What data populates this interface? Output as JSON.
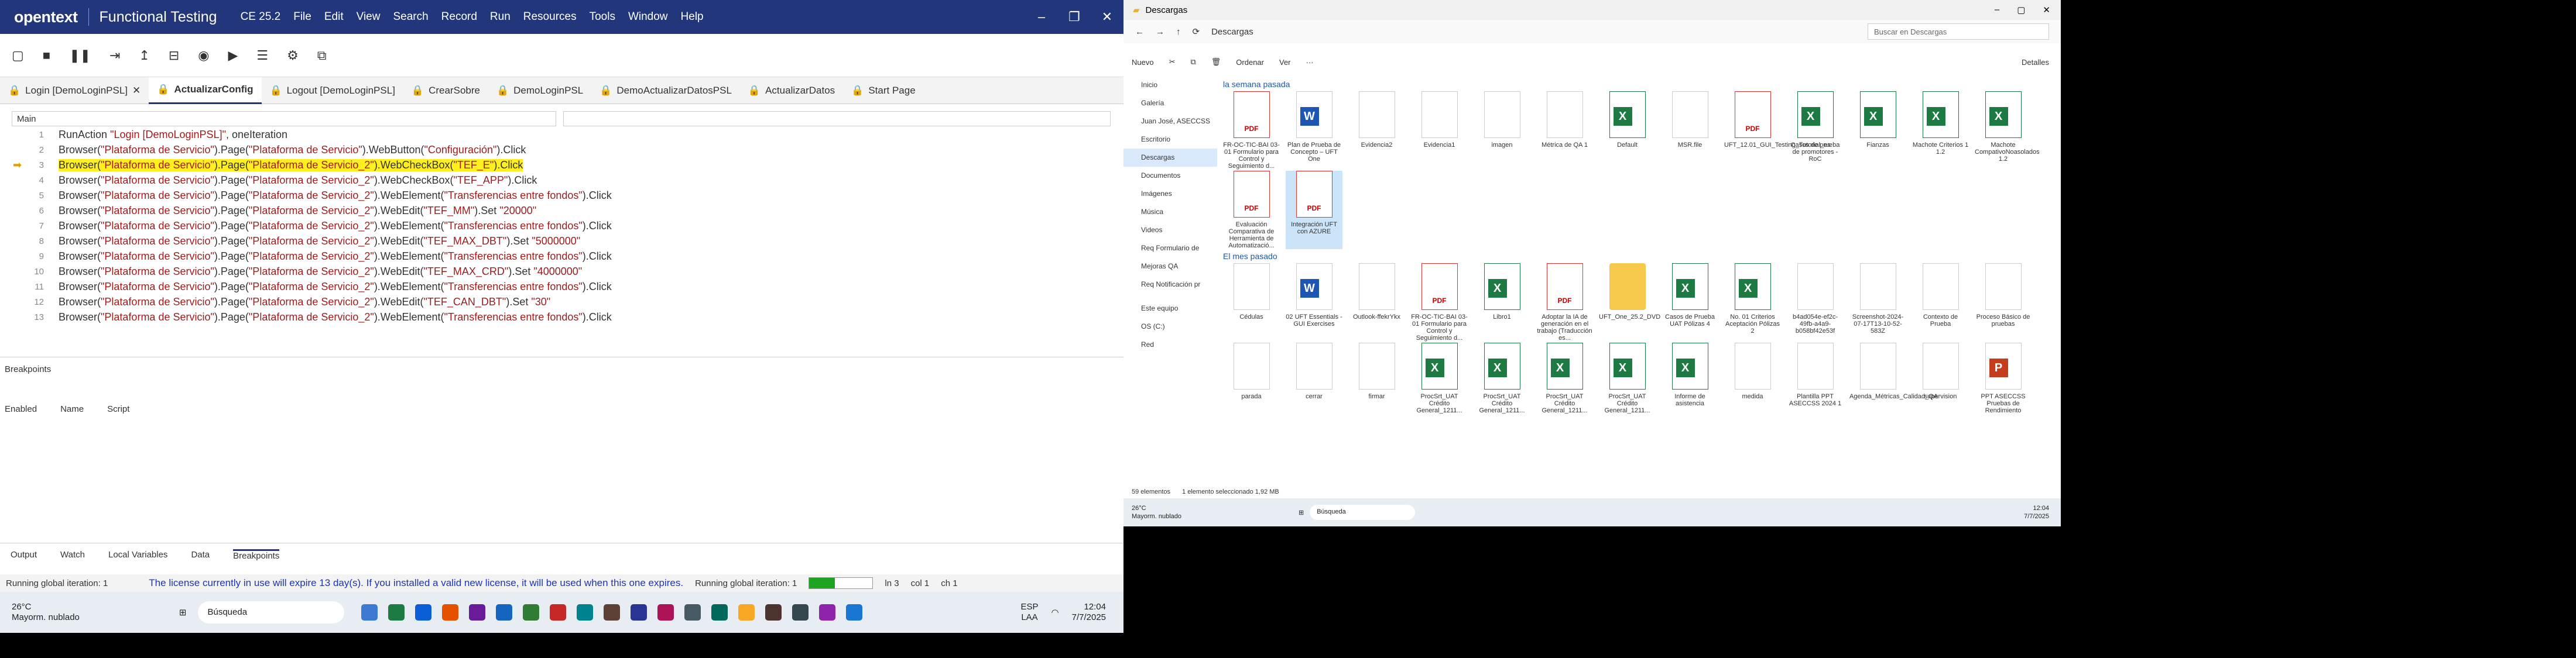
{
  "ide": {
    "logo": "opentext",
    "title": "Functional Testing",
    "version": "CE 25.2",
    "menu": [
      "File",
      "Edit",
      "View",
      "Search",
      "Record",
      "Run",
      "Resources",
      "Tools",
      "Window",
      "Help"
    ],
    "tabs": [
      "Login [DemoLoginPSL]",
      "ActualizarConfig",
      "Logout [DemoLoginPSL]",
      "CrearSobre",
      "DemoLoginPSL",
      "DemoActualizarDatosPSL",
      "ActualizarDatos",
      "Start Page"
    ],
    "combo_left": "Main",
    "lines": [
      {
        "n": "1",
        "t": "RunAction \"Login [DemoLoginPSL]\", oneIteration"
      },
      {
        "n": "2",
        "t": "Browser(\"Plataforma de Servicio\").Page(\"Plataforma de Servicio\").WebButton(\"Configuración\").Click"
      },
      {
        "n": "3",
        "t": "Browser(\"Plataforma de Servicio\").Page(\"Plataforma de Servicio_2\").WebCheckBox(\"TEF_E\").Click"
      },
      {
        "n": "4",
        "t": "Browser(\"Plataforma de Servicio\").Page(\"Plataforma de Servicio_2\").WebCheckBox(\"TEF_APP\").Click"
      },
      {
        "n": "5",
        "t": "Browser(\"Plataforma de Servicio\").Page(\"Plataforma de Servicio_2\").WebElement(\"Transferencias entre fondos\").Click"
      },
      {
        "n": "6",
        "t": "Browser(\"Plataforma de Servicio\").Page(\"Plataforma de Servicio_2\").WebEdit(\"TEF_MM\").Set \"20000\""
      },
      {
        "n": "7",
        "t": "Browser(\"Plataforma de Servicio\").Page(\"Plataforma de Servicio_2\").WebElement(\"Transferencias entre fondos\").Click"
      },
      {
        "n": "8",
        "t": "Browser(\"Plataforma de Servicio\").Page(\"Plataforma de Servicio_2\").WebEdit(\"TEF_MAX_DBT\").Set \"5000000\""
      },
      {
        "n": "9",
        "t": "Browser(\"Plataforma de Servicio\").Page(\"Plataforma de Servicio_2\").WebElement(\"Transferencias entre fondos\").Click"
      },
      {
        "n": "10",
        "t": "Browser(\"Plataforma de Servicio\").Page(\"Plataforma de Servicio_2\").WebEdit(\"TEF_MAX_CRD\").Set \"4000000\""
      },
      {
        "n": "11",
        "t": "Browser(\"Plataforma de Servicio\").Page(\"Plataforma de Servicio_2\").WebElement(\"Transferencias entre fondos\").Click"
      },
      {
        "n": "12",
        "t": "Browser(\"Plataforma de Servicio\").Page(\"Plataforma de Servicio_2\").WebEdit(\"TEF_CAN_DBT\").Set \"30\""
      },
      {
        "n": "13",
        "t": "Browser(\"Plataforma de Servicio\").Page(\"Plataforma de Servicio_2\").WebElement(\"Transferencias entre fondos\").Click"
      }
    ],
    "breakpoints_title": "Breakpoints",
    "bp_cols": [
      "Enabled",
      "Name",
      "Script"
    ],
    "bottom_tabs": [
      "Output",
      "Watch",
      "Local Variables",
      "Data",
      "Breakpoints"
    ],
    "status_left": "Running global iteration: 1",
    "license": "The license currently in use will expire 13 day(s). If you installed a valid new license, it will be used when this one expires.",
    "status_right": "Running global iteration: 1",
    "progress": 0.4,
    "ln": "ln 3",
    "col": "col 1",
    "ch": "ch 1",
    "weather_temp": "26°C",
    "weather_desc": "Mayorm. nublado",
    "search": "Búsqueda",
    "lang": "ESP",
    "lang2": "LAA",
    "time": "12:04",
    "date": "7/7/2025"
  },
  "explorer": {
    "title": "Descargas",
    "address": "Descargas",
    "search": "Buscar en Descargas",
    "cmd": [
      "Nuevo",
      "Ordenar",
      "Ver",
      "Detalles"
    ],
    "nav": [
      "Inicio",
      "Galería",
      "Juan José, ASECCSS",
      "Escritorio",
      "Descargas",
      "Documentos",
      "Imágenes",
      "Música",
      "Videos",
      "Req Formulario de",
      "Mejoras QA",
      "Req Notificación pr",
      "Este equipo",
      "OS (C:)",
      "Red"
    ],
    "week_label": "la semana pasada",
    "month_label": "El mes pasado",
    "week_files": [
      {
        "n": "FR-OC-TIC-BAI 03-01 Formulario para Control y Seguimiento d...",
        "k": "pdf"
      },
      {
        "n": "Plan de Prueba de Concepto – UFT One",
        "k": "wd"
      },
      {
        "n": "Evidencia2",
        "k": "img"
      },
      {
        "n": "Evidencia1",
        "k": "img"
      },
      {
        "n": "imagen",
        "k": "img"
      },
      {
        "n": "Métrica de QA 1",
        "k": "img"
      },
      {
        "n": "Default",
        "k": "xl"
      },
      {
        "n": "MSR.file",
        "k": "blank"
      },
      {
        "n": "UFT_12.01_GUI_Testing_Tutorial_es",
        "k": "pdf"
      },
      {
        "n": "Casos de prueba de promotores - RoC",
        "k": "xl"
      },
      {
        "n": "Fianzas",
        "k": "xl"
      },
      {
        "n": "Machote Criterios 1 1.2",
        "k": "xl"
      },
      {
        "n": "Machote CompativoNoasolados 1.2",
        "k": "xl"
      },
      {
        "n": "Evaluación Comparativa de Herramienta de Automatizació...",
        "k": "pdf"
      },
      {
        "n": "Integración UFT con AZURE",
        "k": "pdf"
      }
    ],
    "month_files": [
      {
        "n": "Cédulas",
        "k": "blank"
      },
      {
        "n": "02 UFT Essentials - GUI Exercises",
        "k": "wd"
      },
      {
        "n": "Outlook-ffekrYkx",
        "k": "blank"
      },
      {
        "n": "FR-OC-TIC-BAI 03-01 Formulario para Control y Seguimiento d...",
        "k": "pdf"
      },
      {
        "n": "Libro1",
        "k": "xl"
      },
      {
        "n": "Adoptar la IA de generación en el trabajo (Traducción es...",
        "k": "pdf"
      },
      {
        "n": "UFT_One_25.2_DVD",
        "k": "folder"
      },
      {
        "n": "Casos de Prueba UAT Pólizas 4",
        "k": "xl"
      },
      {
        "n": "No. 01 Criterios Aceptación Pólizas 2",
        "k": "xl"
      },
      {
        "n": "b4ad054e-ef2c-49fb-a4a9-b058bf42e53f",
        "k": "img"
      },
      {
        "n": "Screenshot-2024-07-17T13-10-52-583Z",
        "k": "img"
      },
      {
        "n": "Contexto de Prueba",
        "k": "img"
      },
      {
        "n": "Proceso Básico de pruebas",
        "k": "img"
      },
      {
        "n": "parada",
        "k": "img"
      },
      {
        "n": "cerrar",
        "k": "img"
      },
      {
        "n": "firmar",
        "k": "img"
      },
      {
        "n": "ProcSrt_UAT Crédito General_1211...",
        "k": "xl"
      },
      {
        "n": "ProcSrt_UAT Crédito General_1211...",
        "k": "xl"
      },
      {
        "n": "ProcSrt_UAT Crédito General_1211...",
        "k": "xl"
      },
      {
        "n": "ProcSrt_UAT Crédito General_1211...",
        "k": "xl"
      },
      {
        "n": "Informe de asistencia",
        "k": "xl"
      },
      {
        "n": "medida",
        "k": "img"
      },
      {
        "n": "Plantilla PPT ASECCSS 2024 1",
        "k": "img"
      },
      {
        "n": "Agenda_Métricas_Calidad_QA",
        "k": "img"
      },
      {
        "n": "supervision",
        "k": "img"
      },
      {
        "n": "PPT ASECCSS Pruebas de Rendimiento",
        "k": "ppt"
      }
    ],
    "status_count": "59 elementos",
    "status_sel": "1 elemento seleccionado 1,92 MB",
    "weather_temp": "26°C",
    "weather_desc": "Mayorm. nublado",
    "search_tb": "Búsqueda",
    "time": "12:04",
    "date": "7/7/2025"
  }
}
